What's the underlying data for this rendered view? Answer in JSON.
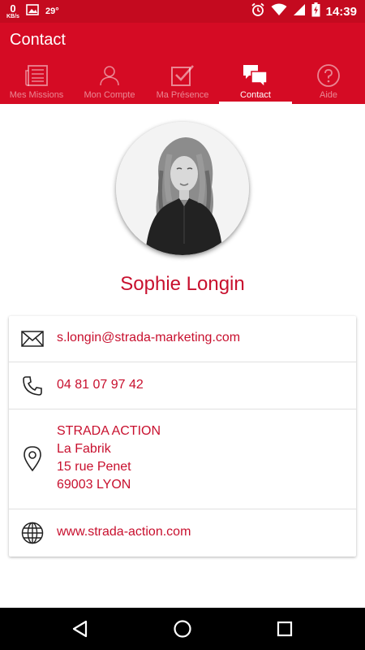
{
  "status_bar": {
    "net_speed_value": "0",
    "net_speed_unit": "KB/s",
    "temperature": "29°",
    "time": "14:39"
  },
  "app_bar": {
    "title": "Contact"
  },
  "tabs": [
    {
      "label": "Mes Missions",
      "icon": "newspaper-icon",
      "active": false
    },
    {
      "label": "Mon Compte",
      "icon": "person-icon",
      "active": false
    },
    {
      "label": "Ma Présence",
      "icon": "checkbox-icon",
      "active": false
    },
    {
      "label": "Contact",
      "icon": "chat-bubbles-icon",
      "active": true
    },
    {
      "label": "Aide",
      "icon": "help-icon",
      "active": false
    }
  ],
  "contact": {
    "name": "Sophie Longin",
    "email": "s.longin@strada-marketing.com",
    "phone": "04 81 07 97 42",
    "address": [
      "STRADA ACTION",
      "La Fabrik",
      "15 rue Penet",
      "69003 LYON"
    ],
    "website": "www.strada-action.com"
  },
  "colors": {
    "primary": "#d50b24",
    "status_bar": "#c40a1f",
    "accent_text": "#c8102e"
  }
}
